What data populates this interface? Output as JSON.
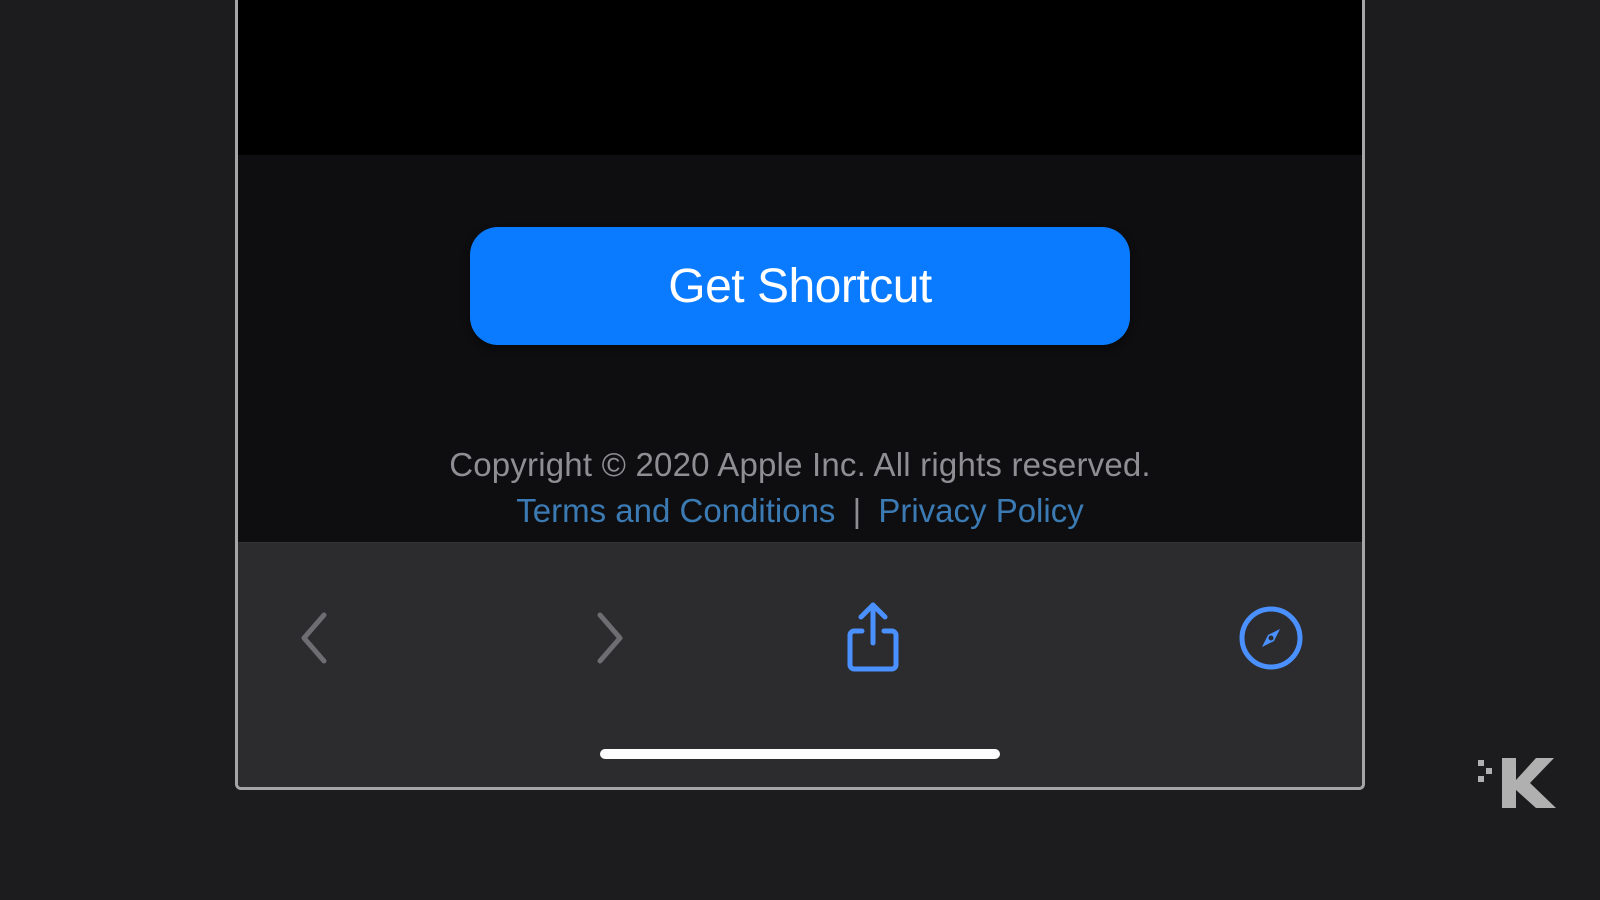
{
  "main": {
    "button_label": "Get Shortcut"
  },
  "footer": {
    "copyright": "Copyright © 2020 Apple Inc. All rights reserved.",
    "terms_label": "Terms and Conditions",
    "separator": "|",
    "privacy_label": "Privacy Policy"
  },
  "toolbar": {
    "icons": {
      "back": "chevron-left-icon",
      "forward": "chevron-right-icon",
      "share": "share-icon",
      "safari": "compass-icon"
    }
  },
  "colors": {
    "accent": "#0a7bff",
    "link": "#3b7ab2",
    "toolbar_icon_blue": "#4a90ff",
    "toolbar_icon_disabled": "#6e6e72"
  }
}
